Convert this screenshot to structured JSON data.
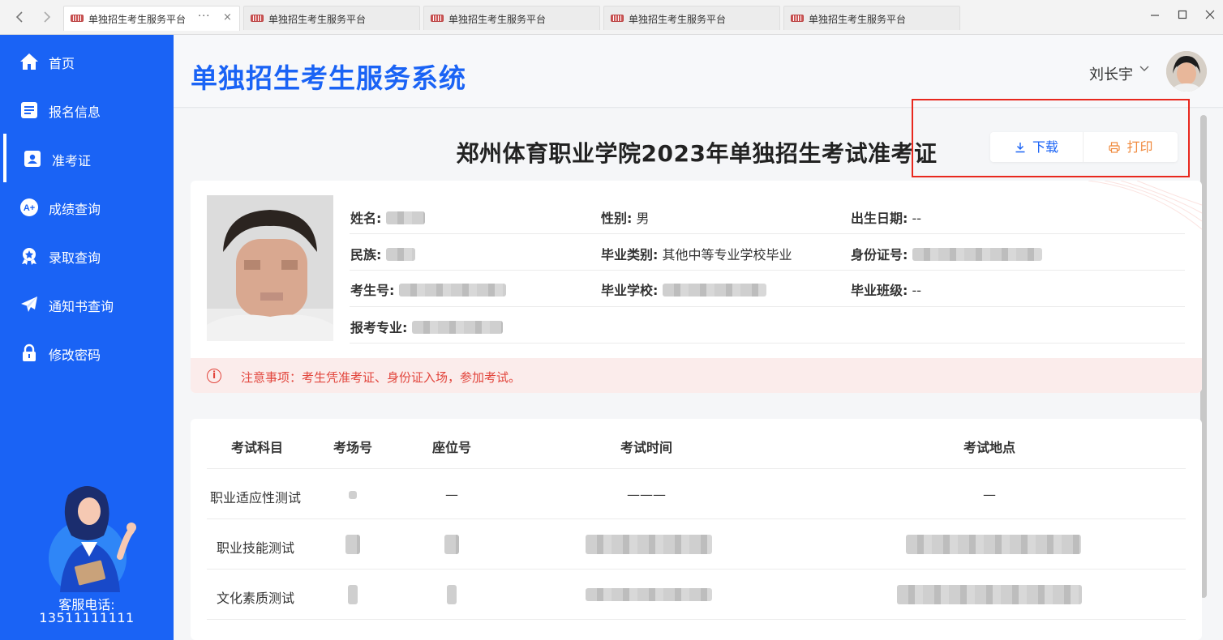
{
  "browser": {
    "tabs": [
      {
        "title": "单独招生考生服务平台",
        "active": true
      },
      {
        "title": "单独招生考生服务平台",
        "active": false
      },
      {
        "title": "单独招生考生服务平台",
        "active": false
      },
      {
        "title": "单独招生考生服务平台",
        "active": false
      },
      {
        "title": "单独招生考生服务平台",
        "active": false
      }
    ],
    "more_glyph": "···",
    "close_glyph": "×",
    "back_icon": "chevron-left-icon",
    "forward_icon": "chevron-right-icon",
    "window_controls": [
      "minimize-icon",
      "maximize-icon",
      "close-icon"
    ]
  },
  "sidebar": {
    "items": [
      {
        "label": "首页",
        "icon": "home-icon",
        "active": false
      },
      {
        "label": "报名信息",
        "icon": "document-icon",
        "active": false
      },
      {
        "label": "准考证",
        "icon": "id-card-icon",
        "active": true
      },
      {
        "label": "成绩查询",
        "icon": "grade-icon",
        "active": false
      },
      {
        "label": "录取查询",
        "icon": "award-icon",
        "active": false
      },
      {
        "label": "通知书查询",
        "icon": "paper-plane-icon",
        "active": false
      },
      {
        "label": "修改密码",
        "icon": "lock-icon",
        "active": false
      }
    ],
    "hotline_label": "客服电话:",
    "hotline_number": "13511111111"
  },
  "header": {
    "system_title": "单独招生考生服务系统",
    "user_name": "刘长宇",
    "user_caret": "∨"
  },
  "ticket": {
    "title": "郑州体育职业学院2023年单独招生考试准考证",
    "download_label": "下载",
    "print_label": "打印",
    "fields": {
      "name_label": "姓名:",
      "gender_label": "性别:",
      "gender_value": "男",
      "birth_label": "出生日期:",
      "birth_value": "--",
      "ethnicity_label": "民族:",
      "grad_type_label": "毕业类别:",
      "grad_type_value": "其他中等专业学校毕业",
      "id_label": "身份证号:",
      "exam_no_label": "考生号:",
      "school_label": "毕业学校:",
      "class_label": "毕业班级:",
      "class_value": "--",
      "major_label": "报考专业:"
    },
    "notice": "注意事项：考生凭准考证、身份证入场，参加考试。",
    "notice_icon_glyph": "i"
  },
  "exam_table": {
    "headers": [
      "考试科目",
      "考场号",
      "座位号",
      "考试时间",
      "考试地点"
    ],
    "rows": [
      {
        "subject": "职业适应性测试",
        "seat": "—",
        "time": "———",
        "place": "—"
      },
      {
        "subject": "职业技能测试"
      },
      {
        "subject": "文化素质测试"
      }
    ]
  }
}
